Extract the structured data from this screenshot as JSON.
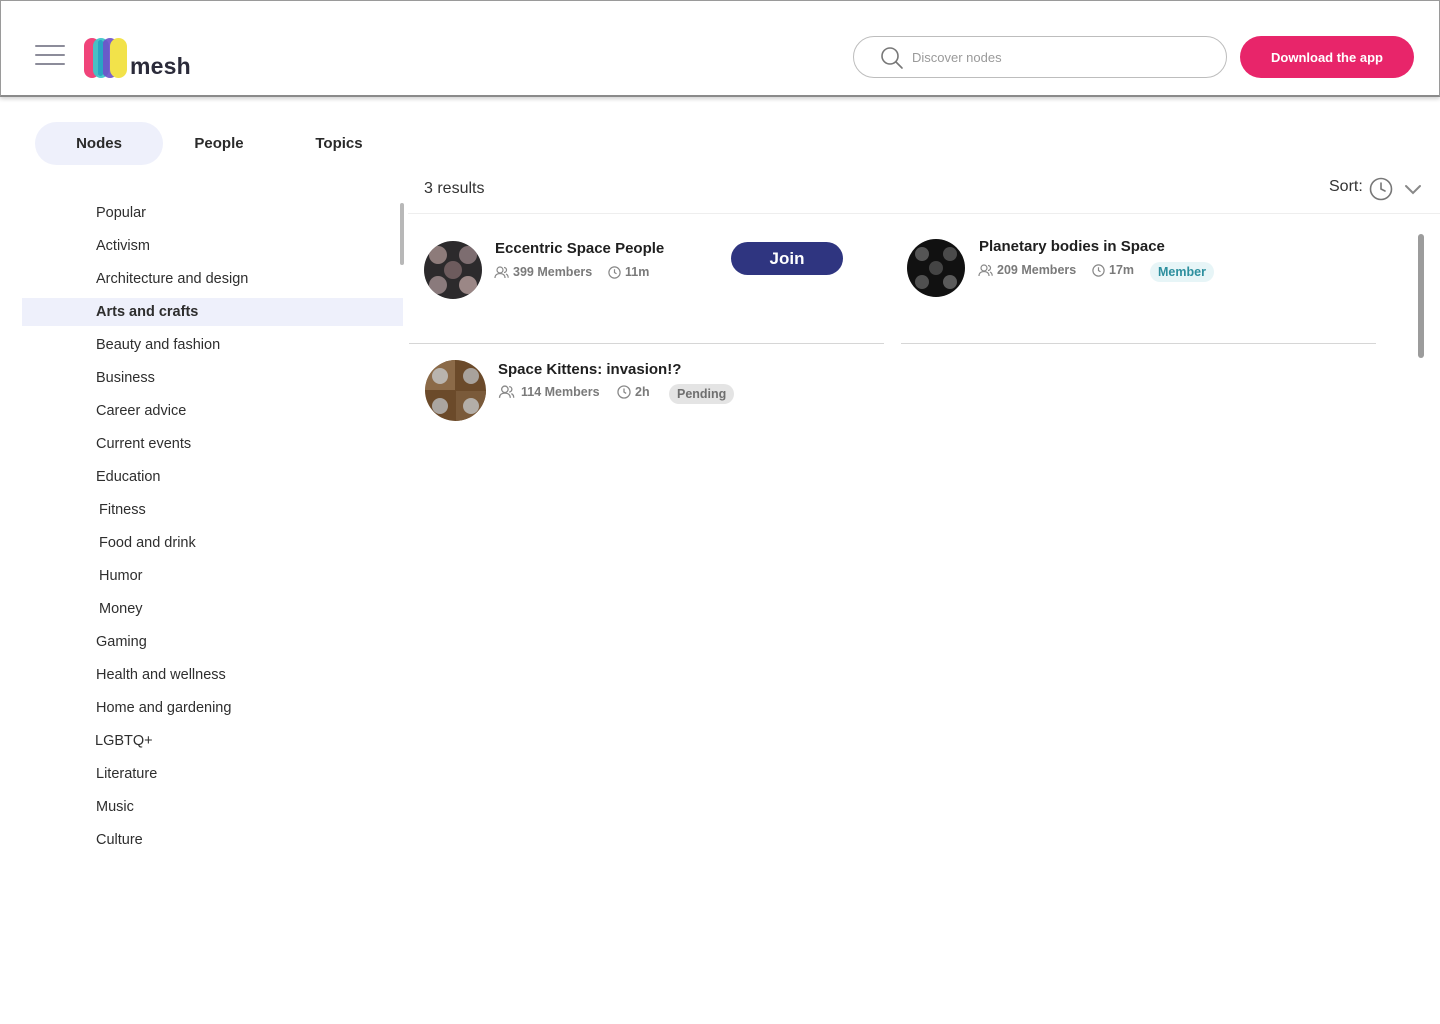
{
  "header": {
    "logo_text": "mesh",
    "search_placeholder": "Discover nodes",
    "download_label": "Download the app",
    "accent_color": "#e8256a"
  },
  "tabs": [
    {
      "label": "Nodes",
      "active": true
    },
    {
      "label": "People",
      "active": false
    },
    {
      "label": "Topics",
      "active": false
    }
  ],
  "categories": [
    "Popular",
    "Activism",
    "Architecture and design",
    "Arts and crafts",
    "Beauty and fashion",
    "Business",
    "Career advice",
    "Current events",
    "Education",
    "Fitness",
    "Food and drink",
    "Humor",
    "Money",
    "Gaming",
    "Health and wellness",
    "Home and gardening",
    "LGBTQ+",
    "Literature",
    "Music",
    "Culture"
  ],
  "active_category": "Arts and crafts",
  "results": {
    "count_label": "3 results",
    "sort_label": "Sort:",
    "items": [
      {
        "title": "Eccentric Space People",
        "members": "399 Members",
        "time": "11m",
        "action": "Join"
      },
      {
        "title": "Planetary bodies in Space",
        "members": "209 Members",
        "time": "17m",
        "status": "Member"
      },
      {
        "title": "Space Kittens: invasion!?",
        "members": "114 Members",
        "time": "2h",
        "status": "Pending"
      }
    ]
  },
  "icons": [
    "menu-icon",
    "search-icon",
    "clock-icon",
    "chevron-down-icon",
    "members-icon"
  ]
}
